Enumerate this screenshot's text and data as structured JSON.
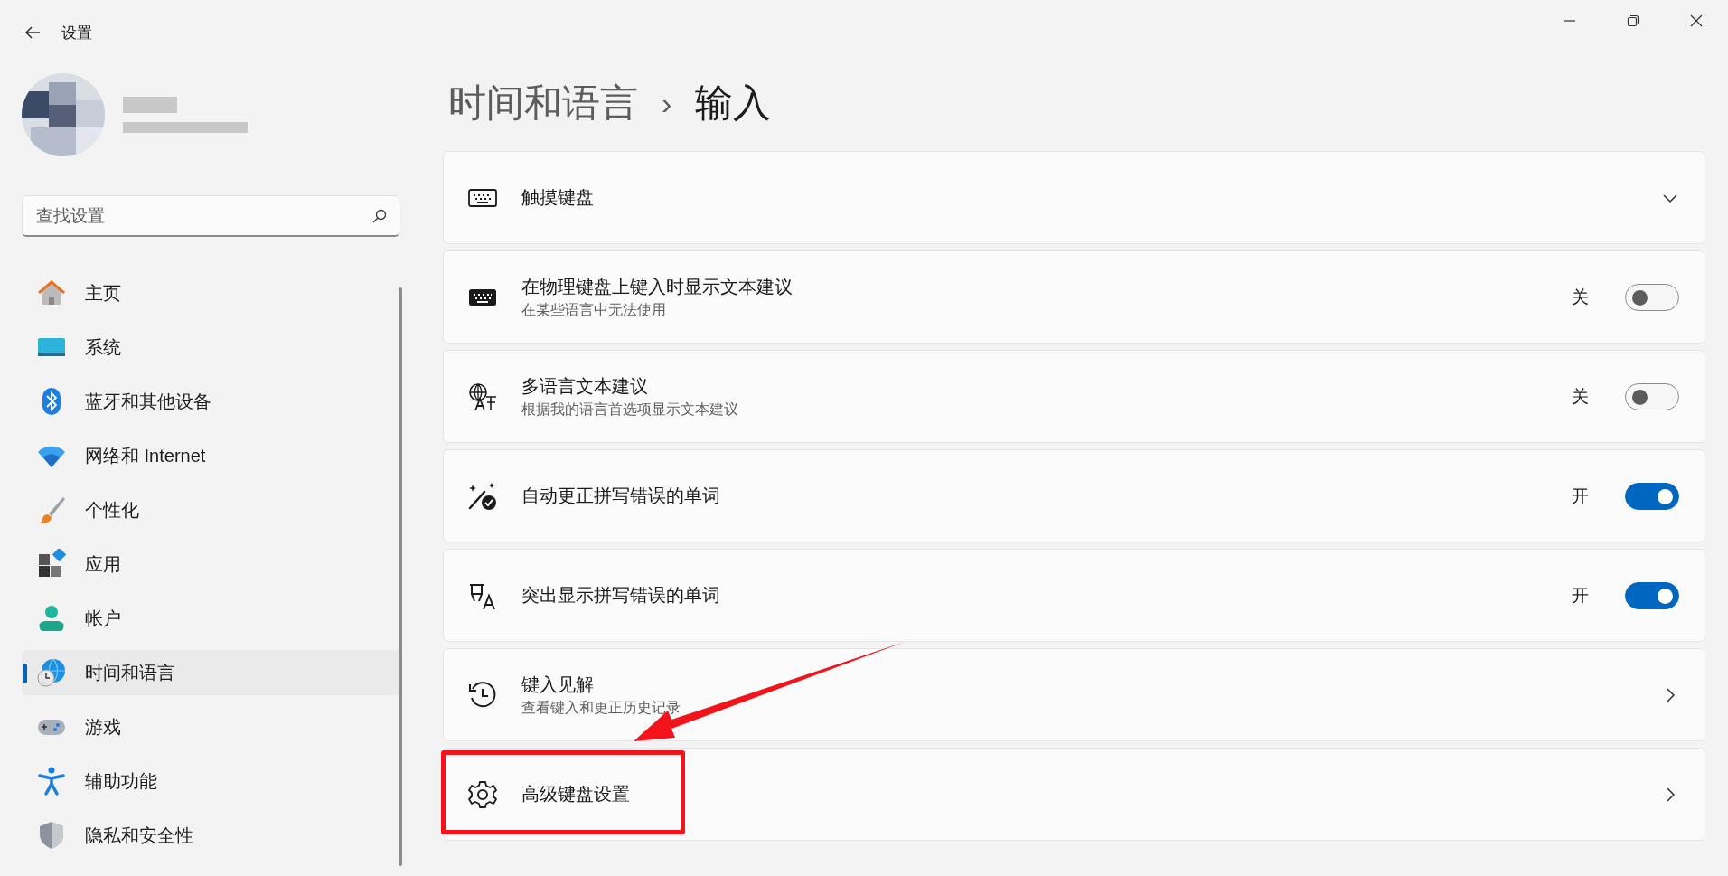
{
  "window": {
    "title": "设置"
  },
  "search": {
    "placeholder": "查找设置"
  },
  "sidebar": {
    "items": [
      {
        "label": "主页",
        "selected": false
      },
      {
        "label": "系统",
        "selected": false
      },
      {
        "label": "蓝牙和其他设备",
        "selected": false
      },
      {
        "label": "网络和 Internet",
        "selected": false
      },
      {
        "label": "个性化",
        "selected": false
      },
      {
        "label": "应用",
        "selected": false
      },
      {
        "label": "帐户",
        "selected": false
      },
      {
        "label": "时间和语言",
        "selected": true
      },
      {
        "label": "游戏",
        "selected": false
      },
      {
        "label": "辅助功能",
        "selected": false
      },
      {
        "label": "隐私和安全性",
        "selected": false
      }
    ]
  },
  "breadcrumb": {
    "parent": "时间和语言",
    "separator": "›",
    "current": "输入"
  },
  "settings": [
    {
      "kind": "expand",
      "title": "触摸键盘",
      "highlighted": false
    },
    {
      "kind": "toggle",
      "title": "在物理键盘上键入时显示文本建议",
      "subtitle": "在某些语言中无法使用",
      "state_text": "关",
      "on": false,
      "highlighted": false
    },
    {
      "kind": "toggle",
      "title": "多语言文本建议",
      "subtitle": "根据我的语言首选项显示文本建议",
      "state_text": "关",
      "on": false,
      "highlighted": false
    },
    {
      "kind": "toggle",
      "title": "自动更正拼写错误的单词",
      "state_text": "开",
      "on": true,
      "highlighted": false
    },
    {
      "kind": "toggle",
      "title": "突出显示拼写错误的单词",
      "state_text": "开",
      "on": true,
      "highlighted": false
    },
    {
      "kind": "link",
      "title": "键入见解",
      "subtitle": "查看键入和更正历史记录",
      "highlighted": false
    },
    {
      "kind": "link",
      "title": "高级键盘设置",
      "highlighted": true
    }
  ]
}
